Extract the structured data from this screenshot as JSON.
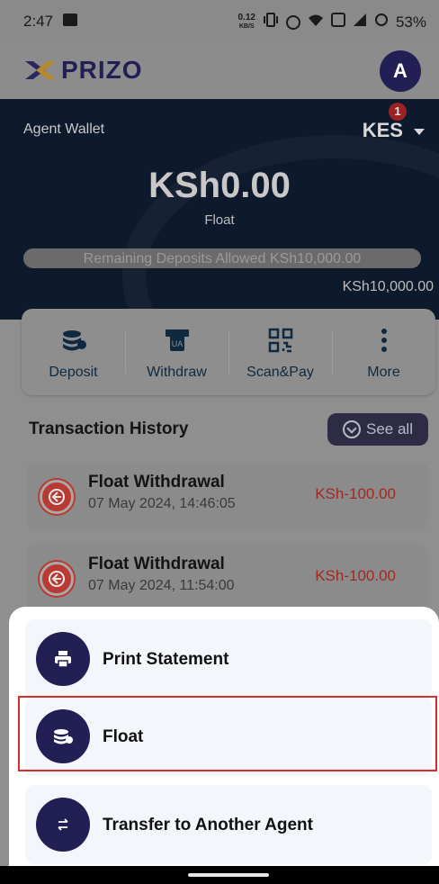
{
  "status_bar": {
    "time": "2:47",
    "net_speed_top": "0.12",
    "net_speed_unit": "KB/S",
    "battery": "53%"
  },
  "header": {
    "brand": "PRIZO",
    "avatar_letter": "A"
  },
  "wallet": {
    "title": "Agent Wallet",
    "currency": "KES",
    "notification_count": "1",
    "balance": "KSh0.00",
    "balance_label": "Float",
    "remaining_text": "Remaining Deposits Allowed KSh10,000.00",
    "remaining_fraction": 1.0,
    "limit": "KSh10,000.00"
  },
  "actions": [
    {
      "label": "Deposit",
      "icon": "coins-icon"
    },
    {
      "label": "Withdraw",
      "icon": "atm-icon"
    },
    {
      "label": "Scan&Pay",
      "icon": "qr-code-icon"
    },
    {
      "label": "More",
      "icon": "more-vertical-icon"
    }
  ],
  "transactions": {
    "title": "Transaction History",
    "see_all": "See all",
    "items": [
      {
        "name": "Float Withdrawal",
        "date": "07 May 2024, 14:46:05",
        "amount": "KSh-100.00"
      },
      {
        "name": "Float Withdrawal",
        "date": "07 May 2024, 11:54:00",
        "amount": "KSh-100.00"
      }
    ]
  },
  "sheet": {
    "options": [
      {
        "label": "Print Statement",
        "icon": "printer-icon"
      },
      {
        "label": "Float",
        "icon": "coins-icon"
      },
      {
        "label": "Transfer to Another Agent",
        "icon": "transfer-arrows-icon"
      }
    ]
  },
  "colors": {
    "brand_navy": "#221f55",
    "highlight_red": "#d32f2f",
    "negative_amount": "#a02a20"
  }
}
